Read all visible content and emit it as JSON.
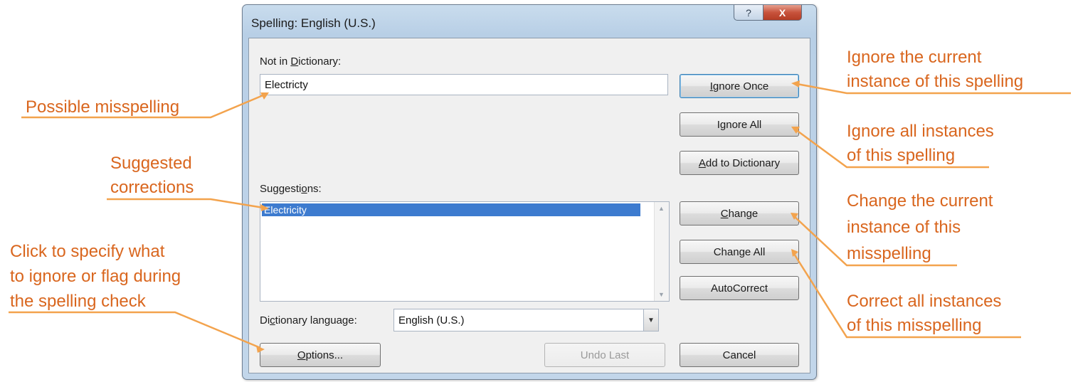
{
  "window": {
    "title": "Spelling: English (U.S.)",
    "help_glyph": "?",
    "close_glyph": "X"
  },
  "not_in_dictionary": {
    "label_pre": "Not in ",
    "label_key": "D",
    "label_post": "ictionary:",
    "value": "Electricty"
  },
  "suggestions": {
    "label_pre": "Suggesti",
    "label_key": "o",
    "label_post": "ns:",
    "items": [
      "Electricity"
    ],
    "selected_index": 0
  },
  "dictionary_language": {
    "label_pre": "Di",
    "label_key": "c",
    "label_post": "tionary language:",
    "value": "English (U.S.)"
  },
  "buttons": {
    "ignore_once": {
      "key": "I",
      "rest": "gnore Once"
    },
    "ignore_all": {
      "pre": "I",
      "key": "g",
      "rest": "nore All"
    },
    "add_to_dictionary": {
      "key": "A",
      "rest": "dd to Dictionary"
    },
    "change": {
      "key": "C",
      "rest": "hange"
    },
    "change_all": {
      "label": "Change All"
    },
    "autocorrect": {
      "label": "AutoCorrect"
    },
    "options": {
      "key": "O",
      "rest": "ptions..."
    },
    "undo_last": {
      "label": "Undo Last"
    },
    "cancel": {
      "label": "Cancel"
    }
  },
  "annotations": {
    "possible_misspelling": "Possible misspelling",
    "suggested_corrections": [
      "Suggested",
      "corrections"
    ],
    "options_hint": [
      "Click to specify what",
      "to ignore or flag during",
      "the spelling check"
    ],
    "ignore_once_hint": [
      "Ignore the current",
      "instance of this spelling"
    ],
    "ignore_all_hint": [
      "Ignore all instances",
      "of this spelling"
    ],
    "change_hint": [
      "Change the current",
      "instance of this",
      "misspelling"
    ],
    "change_all_hint": [
      "Correct all instances",
      "of this misspelling"
    ]
  },
  "colors": {
    "annotation": "#d9661e",
    "selection": "#3d7bcf"
  }
}
